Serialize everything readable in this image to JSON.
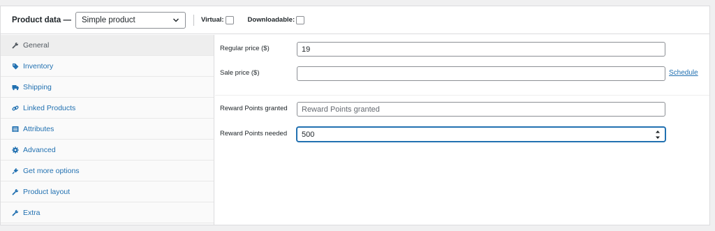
{
  "header": {
    "title": "Product data —",
    "product_type": {
      "selected": "Simple product"
    },
    "virtual_label": "Virtual:",
    "downloadable_label": "Downloadable:"
  },
  "sidebar": {
    "items": [
      {
        "label": "General",
        "icon": "wrench-icon",
        "active": true
      },
      {
        "label": "Inventory",
        "icon": "tag-icon",
        "active": false
      },
      {
        "label": "Shipping",
        "icon": "truck-icon",
        "active": false
      },
      {
        "label": "Linked Products",
        "icon": "link-icon",
        "active": false
      },
      {
        "label": "Attributes",
        "icon": "table-icon",
        "active": false
      },
      {
        "label": "Advanced",
        "icon": "gear-icon",
        "active": false
      },
      {
        "label": "Get more options",
        "icon": "plugin-icon",
        "active": false
      },
      {
        "label": "Product layout",
        "icon": "wrench-icon",
        "active": false
      },
      {
        "label": "Extra",
        "icon": "wrench-icon",
        "active": false
      }
    ]
  },
  "pricing": {
    "regular_price": {
      "label": "Regular price ($)",
      "value": "19"
    },
    "sale_price": {
      "label": "Sale price ($)",
      "value": "",
      "schedule_link": "Schedule"
    }
  },
  "rewards": {
    "granted": {
      "label": "Reward Points granted",
      "placeholder": "Reward Points granted",
      "value": ""
    },
    "needed": {
      "label": "Reward Points needed",
      "value": "500"
    }
  },
  "colors": {
    "link": "#2271b1",
    "border": "#8c8f94",
    "active_tab_bg": "#eeeeee"
  }
}
